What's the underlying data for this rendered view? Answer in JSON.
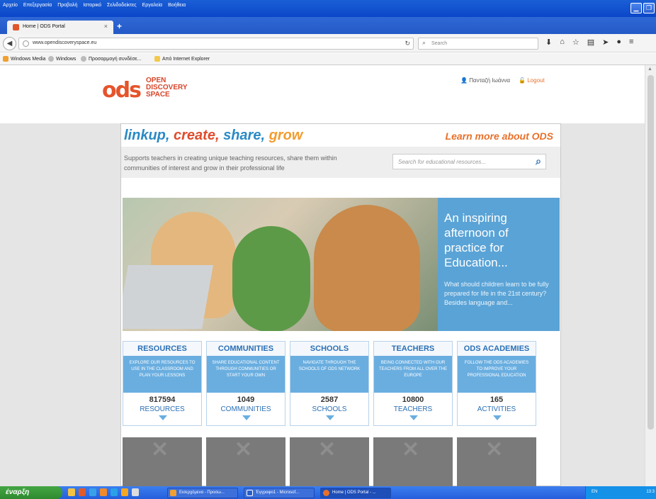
{
  "browser": {
    "menus": [
      "Αρχείο",
      "Επεξεργασία",
      "Προβολή",
      "Ιστορικό",
      "Σελιδοδείκτες",
      "Εργαλεία",
      "Βοήθεια"
    ],
    "tab_title": "Home | ODS Portal",
    "tab_close": "×",
    "new_tab": "+",
    "url": "www.opendiscoveryspace.eu",
    "search_placeholder": "Search",
    "bookmarks": [
      "Windows Media",
      "Windows",
      "Προσαρμογή συνδέσε...",
      "Από Internet Explorer"
    ]
  },
  "site": {
    "logo_ods": "ods",
    "logo_words": [
      "OPEN",
      "DISCOVERY",
      "SPACE"
    ],
    "user_name": "Πανταζή Ιωάννα",
    "logout": "Logout",
    "tagline": [
      "linkup,",
      "create,",
      "share,",
      "grow"
    ],
    "learn_more": "Learn more about ODS",
    "description": "Supports teachers in creating unique teaching resources, share them within communities of interest and grow in their professional life",
    "search_placeholder": "Search for educational resources...",
    "hero_title": "An inspiring afternoon of practice for Education...",
    "hero_text": "What should children learn to be fully prepared for life in the 21st century? Besides language and..."
  },
  "cards": [
    {
      "title": "RESOURCES",
      "desc": "EXPLORE OUR RESOURCES TO USE IN THE CLASSROOM AND PLAN YOUR LESSONS",
      "num": "817594",
      "label": "RESOURCES"
    },
    {
      "title": "COMMUNITIES",
      "desc": "SHARE EDUCATIONAL CONTENT THROUGH COMMUNITIES OR START YOUR OWN",
      "num": "1049",
      "label": "COMMUNITIES"
    },
    {
      "title": "SCHOOLS",
      "desc": "NAVIGATE THROUGH THE SCHOOLS OF ODS NETWORK",
      "num": "2587",
      "label": "SCHOOLS"
    },
    {
      "title": "TEACHERS",
      "desc": "BEING CONNECTED WITH OUR TEACHERS FROM ALL OVER THE EUROPE",
      "num": "10800",
      "label": "TEACHERS"
    },
    {
      "title": "ODS ACADEMIES",
      "desc": "FOLLOW THE ODS ACADEMIES TO IMPROVE YOUR PROFESSIONAL EDUCATION",
      "num": "165",
      "label": "ACTIVITIES"
    }
  ],
  "taskbar": {
    "start": "έναρξη",
    "tasks": [
      "Εισερχόμενα - Προσω...",
      "Έγγραφο1 - Microsof...",
      "Home | ODS Portal - ..."
    ],
    "lang": "EN",
    "time": "13:3"
  }
}
